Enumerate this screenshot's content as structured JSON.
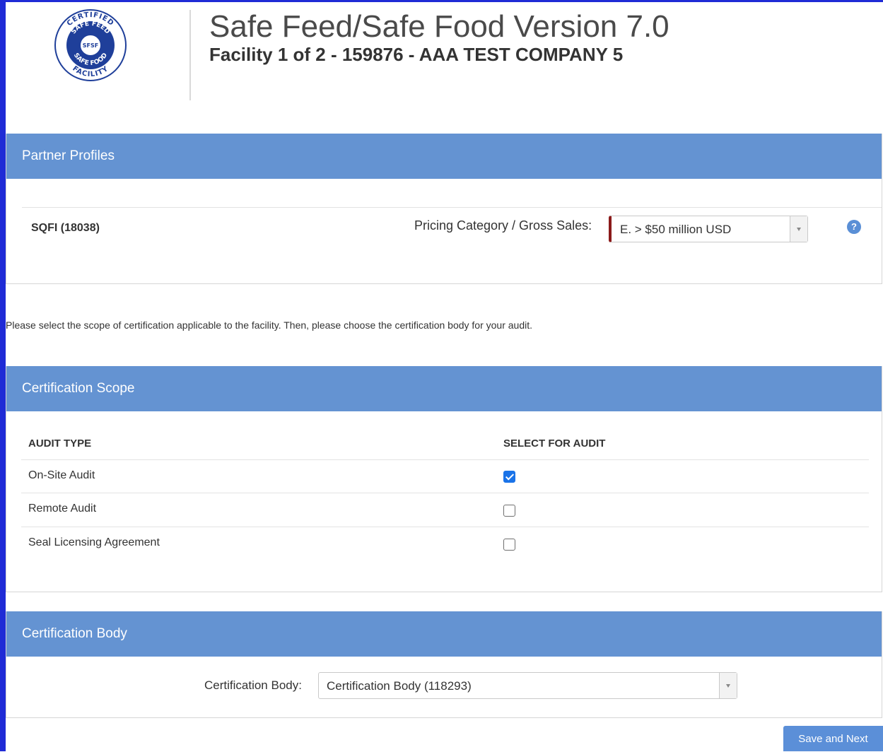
{
  "header": {
    "app_title": "Safe Feed/Safe Food Version 7.0",
    "facility_title": "Facility 1 of 2 - 159876 - AAA TEST COMPANY 5",
    "logo": {
      "top_text": "CERTIFIED",
      "ring_top": "SAFE FEED",
      "center": "SFSF",
      "ring_bottom": "SAFE FOOD",
      "bottom_text": "FACILITY"
    }
  },
  "partner_profiles": {
    "title": "Partner Profiles",
    "partner_name": "SQFI (18038)",
    "pricing_label": "Pricing Category / Gross Sales:",
    "pricing_value": "E. > $50 million USD",
    "help_icon": "?"
  },
  "instructions": "Please select the scope of certification applicable to the facility. Then, please choose the certification body for your audit.",
  "certification_scope": {
    "title": "Certification Scope",
    "col_audit_type": "AUDIT TYPE",
    "col_select": "SELECT FOR AUDIT",
    "rows": [
      {
        "label": "On-Site Audit",
        "checked": true
      },
      {
        "label": "Remote Audit",
        "checked": false
      },
      {
        "label": "Seal Licensing Agreement",
        "checked": false
      }
    ]
  },
  "certification_body": {
    "title": "Certification Body",
    "label": "Certification Body:",
    "value": "Certification Body (118293)"
  },
  "actions": {
    "save_next": "Save and Next"
  },
  "colors": {
    "panel_header": "#6493d2",
    "frame": "#1f2bd6",
    "required_marker": "#8b1a1a",
    "button": "#5b8fd8",
    "checkbox_checked": "#1a73e8"
  }
}
